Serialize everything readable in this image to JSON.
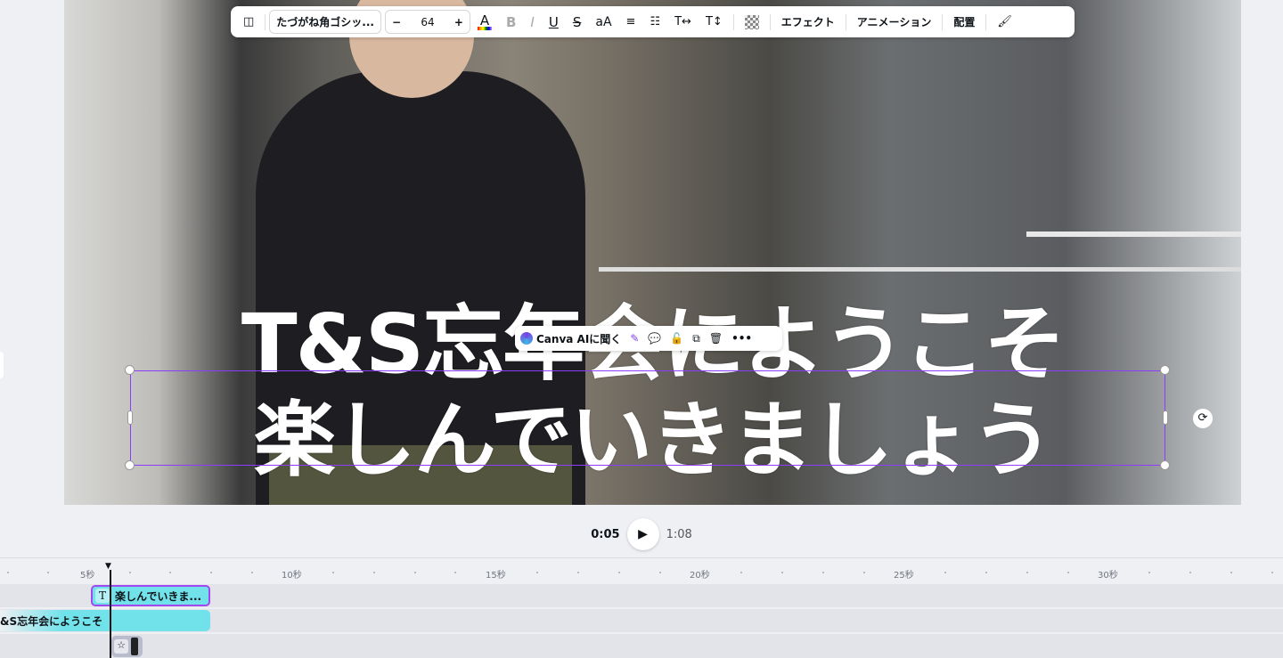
{
  "canvas": {
    "line1": "T&S忘年会にようこそ",
    "line2": "楽しんでいきましょう"
  },
  "toolbar": {
    "font": "たづがね角ゴシッ...",
    "minus": "−",
    "size": "64",
    "plus": "+",
    "text_color": "A",
    "bold": "B",
    "italic": "I",
    "underline": "U",
    "strike": "S",
    "case": "aA",
    "effects": "エフェクト",
    "animation": "アニメーション",
    "position": "配置"
  },
  "context_menu": {
    "ask_ai": "Canva AIに聞く"
  },
  "player": {
    "current": "0:05",
    "total": "1:08"
  },
  "timeline": {
    "ticks": [
      "5秒",
      "10秒",
      "15秒",
      "20秒",
      "25秒",
      "30秒"
    ],
    "clips": [
      "楽しんでいきま...",
      "&S忘年会にようこそ"
    ]
  }
}
